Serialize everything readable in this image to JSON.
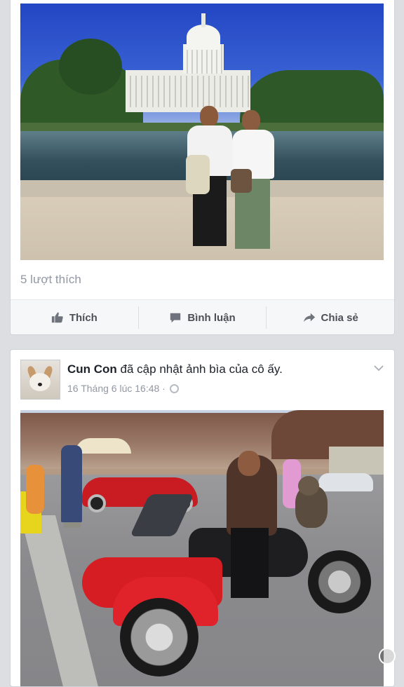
{
  "post1": {
    "photo_alt": "",
    "likes_text": "5 lượt thích",
    "actions": {
      "like_label": "Thích",
      "comment_label": "Bình luận",
      "share_label": "Chia sẻ"
    }
  },
  "post2": {
    "author": "Cun Con",
    "action_text": " đã cập nhật ảnh bìa của cô ấy.",
    "timestamp": "16 Tháng 6 lúc 16:48 ·",
    "photo_alt": ""
  },
  "colors": {
    "background": "#dcdee2",
    "card": "#ffffff",
    "secondary_text": "#9197a3",
    "action_text": "#4b4f56"
  },
  "icons": {
    "like": "thumbs-up-icon",
    "comment": "comment-icon",
    "share": "share-arrow-icon",
    "privacy": "globe-icon",
    "menu": "chevron-down-icon",
    "home": "assistive-touch-icon"
  }
}
